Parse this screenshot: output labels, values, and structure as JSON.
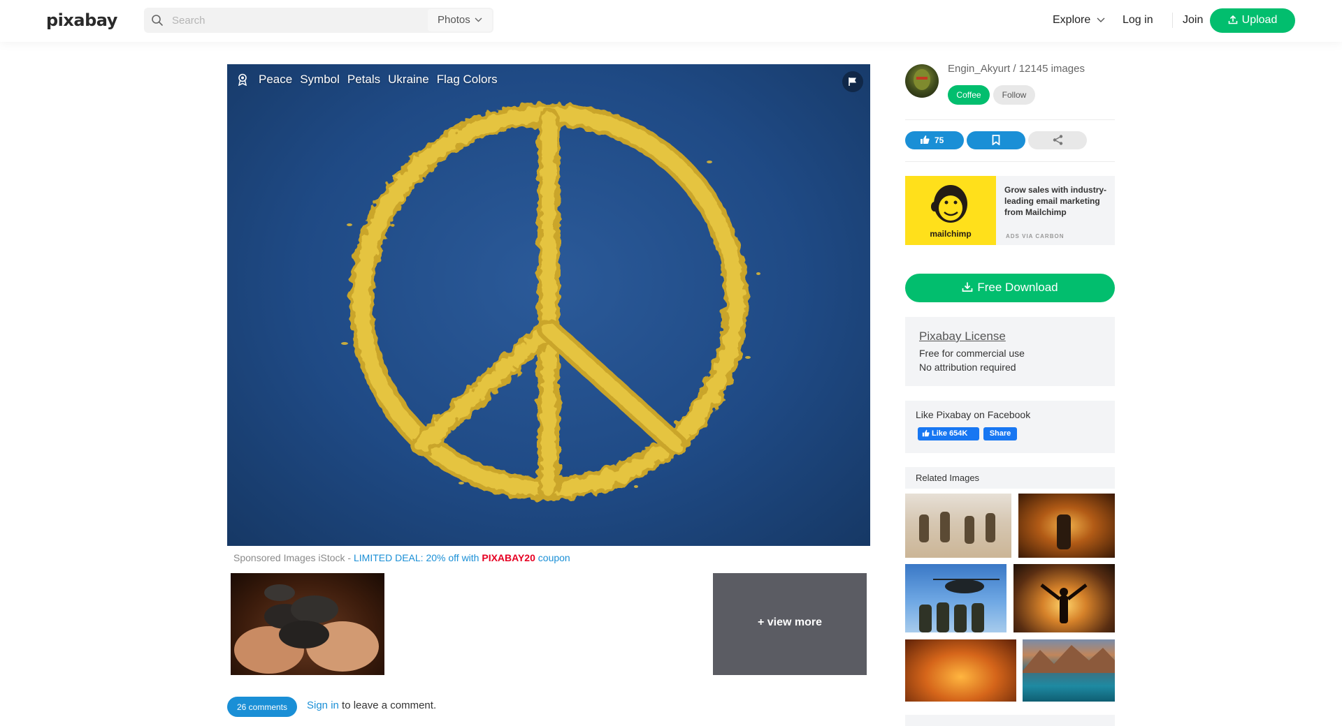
{
  "header": {
    "logo": "pixabay",
    "search_placeholder": "Search",
    "search_type": "Photos",
    "nav": {
      "explore": "Explore",
      "login": "Log in",
      "join": "Join",
      "upload": "Upload"
    }
  },
  "image": {
    "tags": [
      "Peace",
      "Symbol",
      "Petals",
      "Ukraine",
      "Flag Colors"
    ]
  },
  "sponsored": {
    "prefix": "Sponsored Images iStock - ",
    "deal": "LIMITED DEAL: 20% off with ",
    "coupon": "PIXABAY20",
    "suffix": " coupon",
    "view_more": "+ view more"
  },
  "comments": {
    "count_label": "26 comments",
    "signin": "Sign in",
    "signin_suffix": " to leave a comment."
  },
  "author": {
    "line": "Engin_Akyurt / 12145 images",
    "coffee": "Coffee",
    "follow": "Follow"
  },
  "actions": {
    "likes": "75"
  },
  "ad": {
    "brand": "mailchimp",
    "text": "Grow sales with industry-leading email marketing from Mailchimp",
    "via": "ADS VIA CARBON"
  },
  "download": {
    "label": "Free Download"
  },
  "license": {
    "title": "Pixabay License",
    "line1": "Free for commercial use",
    "line2": "No attribution required"
  },
  "facebook": {
    "title": "Like Pixabay on Facebook",
    "like": "Like 654K",
    "share": "Share"
  },
  "related": {
    "title": "Related Images"
  },
  "colors": {
    "brand_green": "#02be6e",
    "link_blue": "#1a8fd6",
    "coupon_red": "#e60023"
  }
}
